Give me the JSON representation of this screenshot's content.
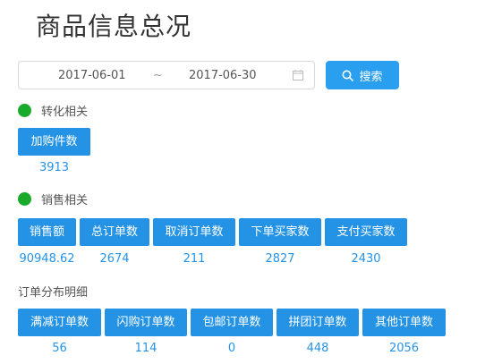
{
  "page": {
    "title": "商品信息总况"
  },
  "filter": {
    "start_date": "2017-06-01",
    "separator": "~",
    "end_date": "2017-06-30",
    "search_label": "搜索",
    "accent": "#2a9ff0"
  },
  "conversion": {
    "heading": "转化相关",
    "status_color": "#1aaa2b",
    "metrics": [
      {
        "label": "加购件数",
        "value": "3913"
      }
    ]
  },
  "sales": {
    "heading": "销售相关",
    "status_color": "#1aaa2b",
    "metrics": [
      {
        "label": "销售额",
        "value": "90948.62"
      },
      {
        "label": "总订单数",
        "value": "2674"
      },
      {
        "label": "取消订单数",
        "value": "211"
      },
      {
        "label": "下单买家数",
        "value": "2827"
      },
      {
        "label": "支付买家数",
        "value": "2430"
      }
    ]
  },
  "orders": {
    "heading": "订单分布明细",
    "metrics": [
      {
        "label": "满减订单数",
        "value": "56"
      },
      {
        "label": "闪购订单数",
        "value": "114"
      },
      {
        "label": "包邮订单数",
        "value": "0"
      },
      {
        "label": "拼团订单数",
        "value": "448"
      },
      {
        "label": "其他订单数",
        "value": "2056"
      }
    ]
  }
}
